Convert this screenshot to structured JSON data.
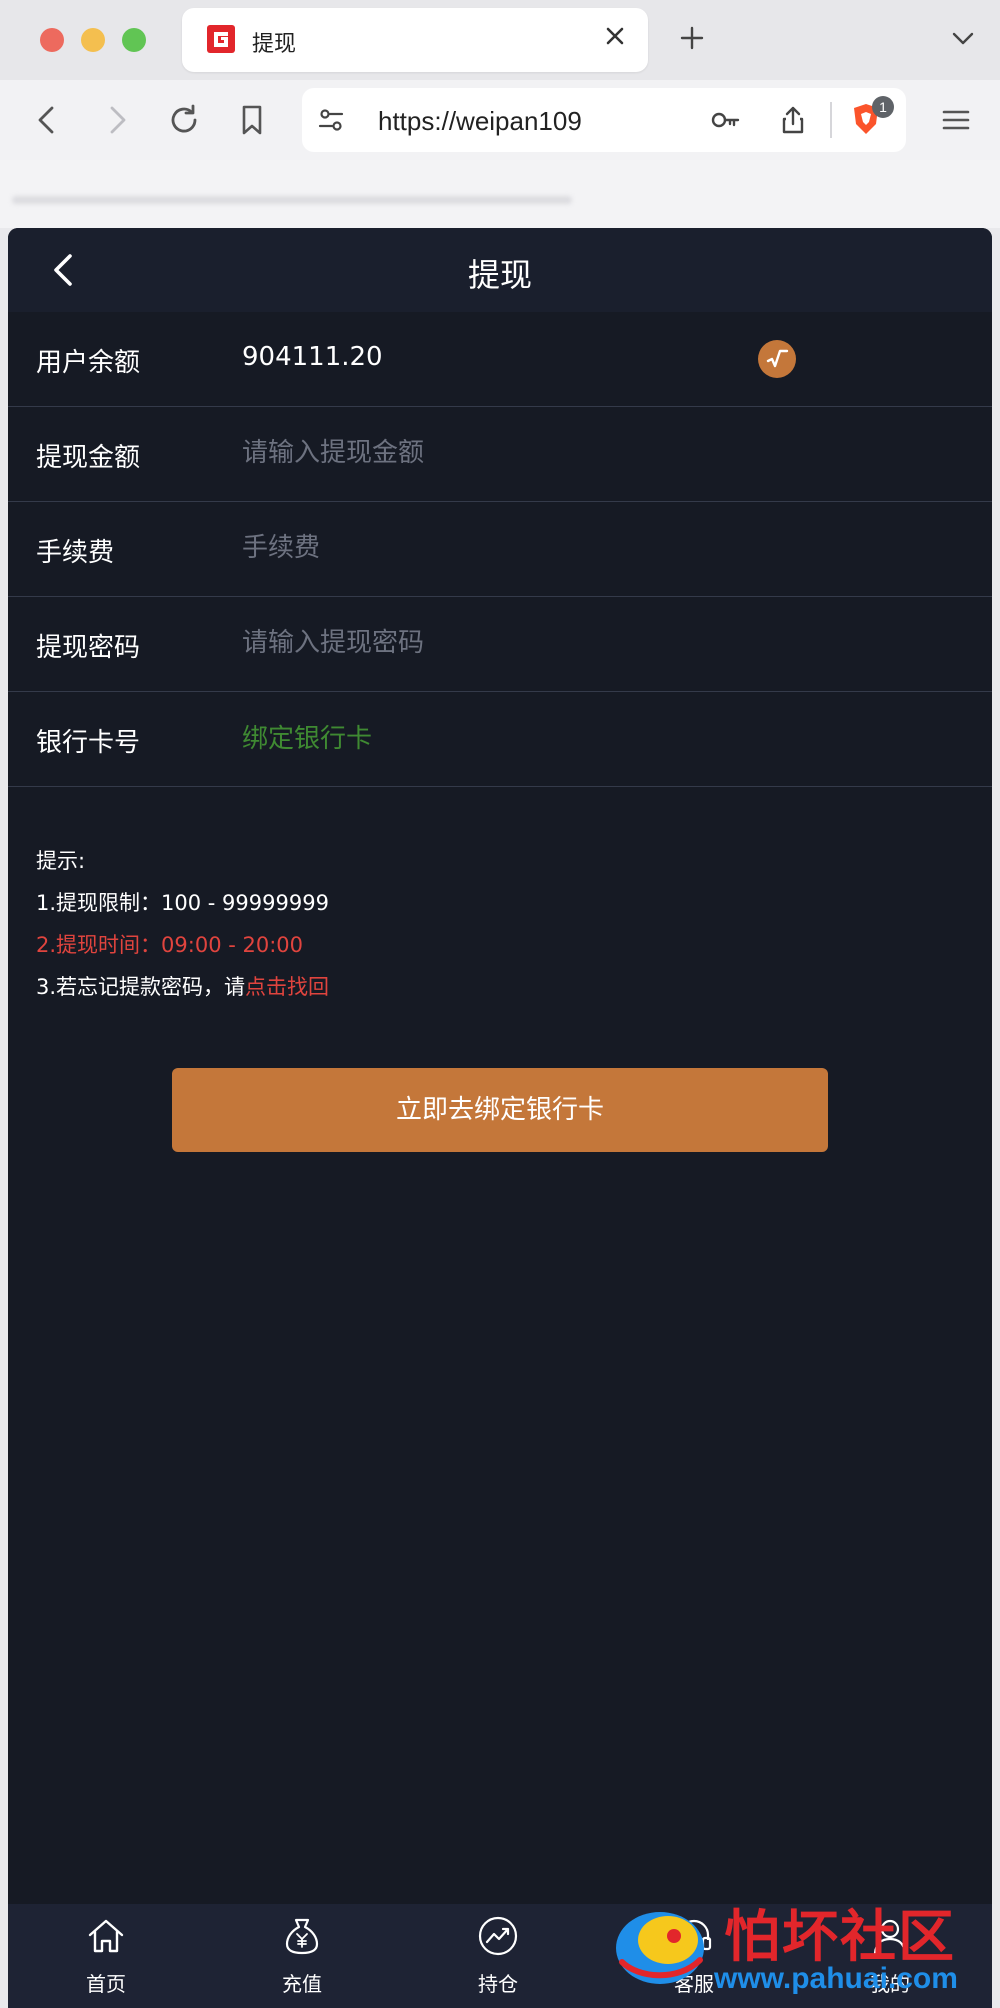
{
  "browser": {
    "tab_title": "提现",
    "url": "https://weipan109",
    "shields_badge": "1"
  },
  "header": {
    "title": "提现"
  },
  "form": {
    "balance_label": "用户余额",
    "balance_value": "904111.20",
    "amount_label": "提现金额",
    "amount_placeholder": "请输入提现金额",
    "fee_label": "手续费",
    "fee_placeholder": "手续费",
    "password_label": "提现密码",
    "password_placeholder": "请输入提现密码",
    "bank_label": "银行卡号",
    "bank_link": "绑定银行卡"
  },
  "tips": {
    "title": "提示:",
    "line1": "1.提现限制：100 - 99999999",
    "line2": "2.提现时间：09:00 - 20:00",
    "line3_prefix": "3.若忘记提款密码，请",
    "line3_link": "点击找回"
  },
  "submit_label": "立即去绑定银行卡",
  "bottom_nav": {
    "items": [
      {
        "label": "首页",
        "icon": "home-icon"
      },
      {
        "label": "充值",
        "icon": "money-bag-icon"
      },
      {
        "label": "持仓",
        "icon": "chart-icon"
      },
      {
        "label": "客服",
        "icon": "headset-icon"
      },
      {
        "label": "我的",
        "icon": "user-icon"
      }
    ]
  },
  "watermark": {
    "title": "怕坏社区",
    "url": "www.pahuai.com"
  },
  "colors": {
    "accent": "#c4773a",
    "background": "#161a24",
    "link_green": "#3f8a32",
    "warning_red": "#e0443e"
  }
}
